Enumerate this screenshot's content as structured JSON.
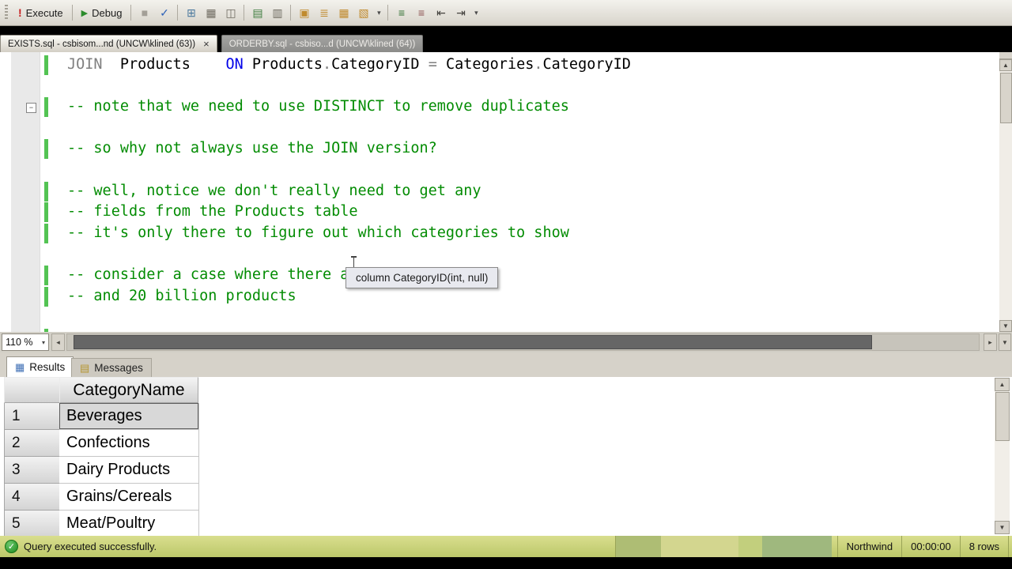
{
  "icons": {
    "close": "×",
    "dropdown": "▾",
    "collapse": "−",
    "scroll_left": "◂",
    "scroll_right": "▸",
    "scroll_up": "▲",
    "scroll_down": "▼",
    "check": "✓",
    "execute": "!",
    "play": "▶"
  },
  "toolbar": {
    "execute_label": "Execute",
    "debug_label": "Debug",
    "icons": [
      {
        "sep": true
      },
      {
        "name": "cancel-query-icon",
        "glyph": "■",
        "color": "#a39f97"
      },
      {
        "name": "parse-icon",
        "glyph": "✓",
        "color": "#2d62b8"
      },
      {
        "sep": true
      },
      {
        "name": "estimated-plan-icon",
        "glyph": "⊞",
        "color": "#4c7a9e"
      },
      {
        "name": "query-designer-icon",
        "glyph": "▦",
        "color": "#6f6b61"
      },
      {
        "name": "template-parameters-icon",
        "glyph": "◫",
        "color": "#6f6b61"
      },
      {
        "sep": true
      },
      {
        "name": "actual-plan-icon",
        "glyph": "▤",
        "color": "#3f7d3f"
      },
      {
        "name": "client-statistics-icon",
        "glyph": "▥",
        "color": "#6f6b61"
      },
      {
        "sep": true
      },
      {
        "name": "sqlcmd-mode-icon",
        "glyph": "▣",
        "color": "#c08a2d"
      },
      {
        "name": "results-to-text-icon",
        "glyph": "≣",
        "color": "#c08a2d"
      },
      {
        "name": "results-to-grid-icon",
        "glyph": "▦",
        "color": "#c08a2d"
      },
      {
        "name": "results-to-file-icon",
        "glyph": "▧",
        "color": "#c08a2d"
      },
      {
        "name": "dropdown-arrow-icon",
        "glyph": "▾",
        "color": "#4a4a4a",
        "narrow": true
      },
      {
        "sep": true
      },
      {
        "name": "comment-icon",
        "glyph": "≡",
        "color": "#2f6f2f"
      },
      {
        "name": "uncomment-icon",
        "glyph": "≡",
        "color": "#8a4f4f"
      },
      {
        "name": "decrease-indent-icon",
        "glyph": "⇤",
        "color": "#44423e"
      },
      {
        "name": "increase-indent-icon",
        "glyph": "⇥",
        "color": "#44423e"
      },
      {
        "name": "toolbar-options-icon",
        "glyph": "▾",
        "color": "#4a4a4a",
        "narrow": true
      }
    ]
  },
  "tabs": [
    {
      "label": "EXISTS.sql - csbisom...nd (UNCW\\klined (63))",
      "close": "×"
    },
    {
      "label": "ORDERBY.sql - csbiso...d (UNCW\\klined (64))"
    }
  ],
  "editor": {
    "lines": [
      {
        "bar": true,
        "segments": [
          {
            "text": "JOIN",
            "cls": "kw-gray"
          },
          {
            "text": "  Products    ",
            "cls": "plain"
          },
          {
            "text": "ON",
            "cls": "kw-blue"
          },
          {
            "text": " Products",
            "cls": "plain"
          },
          {
            "text": ".",
            "cls": "op"
          },
          {
            "text": "CategoryID",
            "cls": "plain"
          },
          {
            "text": " ",
            "cls": "plain"
          },
          {
            "text": "=",
            "cls": "op"
          },
          {
            "text": " Categories",
            "cls": "plain"
          },
          {
            "text": ".",
            "cls": "op"
          },
          {
            "text": "CategoryID",
            "cls": "plain"
          }
        ]
      },
      {
        "segments": []
      },
      {
        "bar": true,
        "collapse": true,
        "segments": [
          {
            "text": "-- note that we need to use DISTINCT to remove duplicates",
            "cls": "comment"
          }
        ]
      },
      {
        "segments": []
      },
      {
        "bar": true,
        "segments": [
          {
            "text": "-- so why not always use the JOIN version?",
            "cls": "comment"
          }
        ]
      },
      {
        "segments": []
      },
      {
        "bar": true,
        "segments": [
          {
            "text": "-- well, notice we don't really need to get any",
            "cls": "comment"
          }
        ]
      },
      {
        "bar": true,
        "segments": [
          {
            "text": "-- fields from the Products table",
            "cls": "comment"
          }
        ]
      },
      {
        "bar": true,
        "segments": [
          {
            "text": "-- it's only there to figure out which categories to show",
            "cls": "comment"
          }
        ]
      },
      {
        "segments": []
      },
      {
        "bar": true,
        "segments": [
          {
            "text": "-- consider a case where there ar",
            "cls": "comment"
          }
        ]
      },
      {
        "bar": true,
        "segments": [
          {
            "text": "-- and 20 billion products",
            "cls": "comment"
          }
        ]
      },
      {
        "segments": []
      },
      {
        "bar": true,
        "segments": [
          {
            "text": "--",
            "cls": "comment"
          }
        ]
      }
    ]
  },
  "tooltip": {
    "text": "column CategoryID(int, null)"
  },
  "zoom": {
    "value": "110 %"
  },
  "results_tabs": [
    {
      "label": "Results"
    },
    {
      "label": "Messages"
    }
  ],
  "grid": {
    "columns": [
      "CategoryName"
    ],
    "rows": [
      {
        "num": "1",
        "value": "Beverages",
        "selected": true
      },
      {
        "num": "2",
        "value": "Confections"
      },
      {
        "num": "3",
        "value": "Dairy Products"
      },
      {
        "num": "4",
        "value": "Grains/Cereals"
      },
      {
        "num": "5",
        "value": "Meat/Poultry"
      }
    ]
  },
  "status": {
    "message": "Query executed successfully.",
    "database": "Northwind",
    "time": "00:00:00",
    "rows": "8 rows"
  }
}
